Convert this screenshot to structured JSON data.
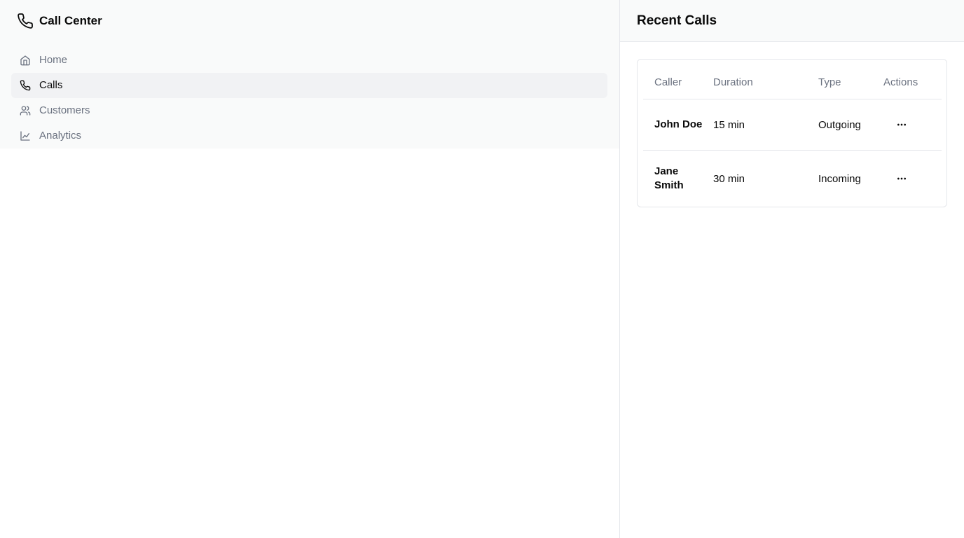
{
  "app": {
    "title": "Call Center",
    "logo_icon": "phone-icon"
  },
  "sidebar": {
    "items": [
      {
        "label": "Home",
        "icon": "home-icon",
        "active": false
      },
      {
        "label": "Calls",
        "icon": "phone-icon",
        "active": true
      },
      {
        "label": "Customers",
        "icon": "users-icon",
        "active": false
      },
      {
        "label": "Analytics",
        "icon": "line-chart-icon",
        "active": false
      }
    ]
  },
  "recent_calls": {
    "title": "Recent Calls",
    "columns": [
      "Caller",
      "Duration",
      "Type",
      "Actions"
    ],
    "rows": [
      {
        "caller": "John Doe",
        "duration": "15 min",
        "type": "Outgoing",
        "actions_icon": "more-horizontal-icon"
      },
      {
        "caller": "Jane Smith",
        "duration": "30 min",
        "type": "Incoming",
        "actions_icon": "more-horizontal-icon"
      }
    ]
  },
  "colors": {
    "panel_bg": "#f9fafa",
    "active_bg": "#f1f2f4",
    "muted_text": "#6b7280",
    "border": "#e5e7eb",
    "text": "#0a0a0a"
  }
}
